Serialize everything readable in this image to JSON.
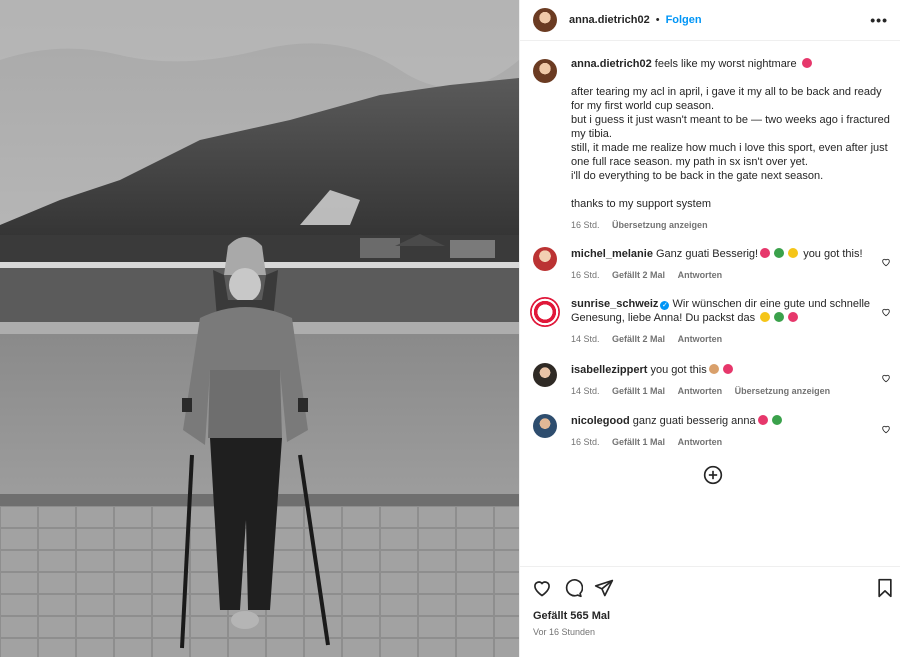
{
  "post": {
    "username": "anna.dietrich02",
    "dot": "•",
    "follow_label": "Folgen",
    "more_label": "•••"
  },
  "caption": {
    "username": "anna.dietrich02",
    "lines": [
      "feels like my worst nightmare",
      "",
      "after tearing my acl in april, i gave it my all to be back and ready for my first world cup season.",
      "but i guess it just wasn't meant to be — two weeks ago i fractured my tibia.",
      "still, it made me realize how much i love this sport, even after just one full race season. my path in sx isn't over yet.",
      "i'll do everything to be back in the gate next season.",
      "",
      "thanks to my support system"
    ],
    "time": "16 Std.",
    "translate": "Übersetzung anzeigen"
  },
  "comments": [
    {
      "username": "michel_melanie",
      "text": "Ganz guati Besserig!",
      "text_tail": "you got this!",
      "time": "16 Std.",
      "likes": "Gefällt 2 Mal",
      "reply": "Antworten",
      "translate": ""
    },
    {
      "username": "sunrise_schweiz",
      "text": "Wir wünschen dir eine gute und schnelle Genesung, liebe Anna! Du packst das",
      "text_tail": "",
      "time": "14 Std.",
      "likes": "Gefällt 2 Mal",
      "reply": "Antworten",
      "translate": ""
    },
    {
      "username": "isabellezippert",
      "text": "you got this",
      "text_tail": "",
      "time": "14 Std.",
      "likes": "Gefällt 1 Mal",
      "reply": "Antworten",
      "translate": "Übersetzung anzeigen"
    },
    {
      "username": "nicolegood",
      "text": "ganz guati besserig anna",
      "text_tail": "",
      "time": "16 Std.",
      "likes": "Gefällt 1 Mal",
      "reply": "Antworten",
      "translate": ""
    }
  ],
  "footer": {
    "likes": "Gefällt 565 Mal",
    "ago": "Vor 16 Stunden"
  },
  "icons": {
    "like": "heart-icon",
    "comment": "comment-icon",
    "share": "share-icon",
    "save": "bookmark-icon",
    "more_comments": "plus-circle-icon",
    "verified": "verified-badge-icon"
  },
  "colors": {
    "link_blue": "#0095f6",
    "text": "#262626",
    "muted": "#737373",
    "emoji_heart": "#e6376b",
    "emoji_clover": "#3aa14b",
    "emoji_star": "#f5c518"
  }
}
